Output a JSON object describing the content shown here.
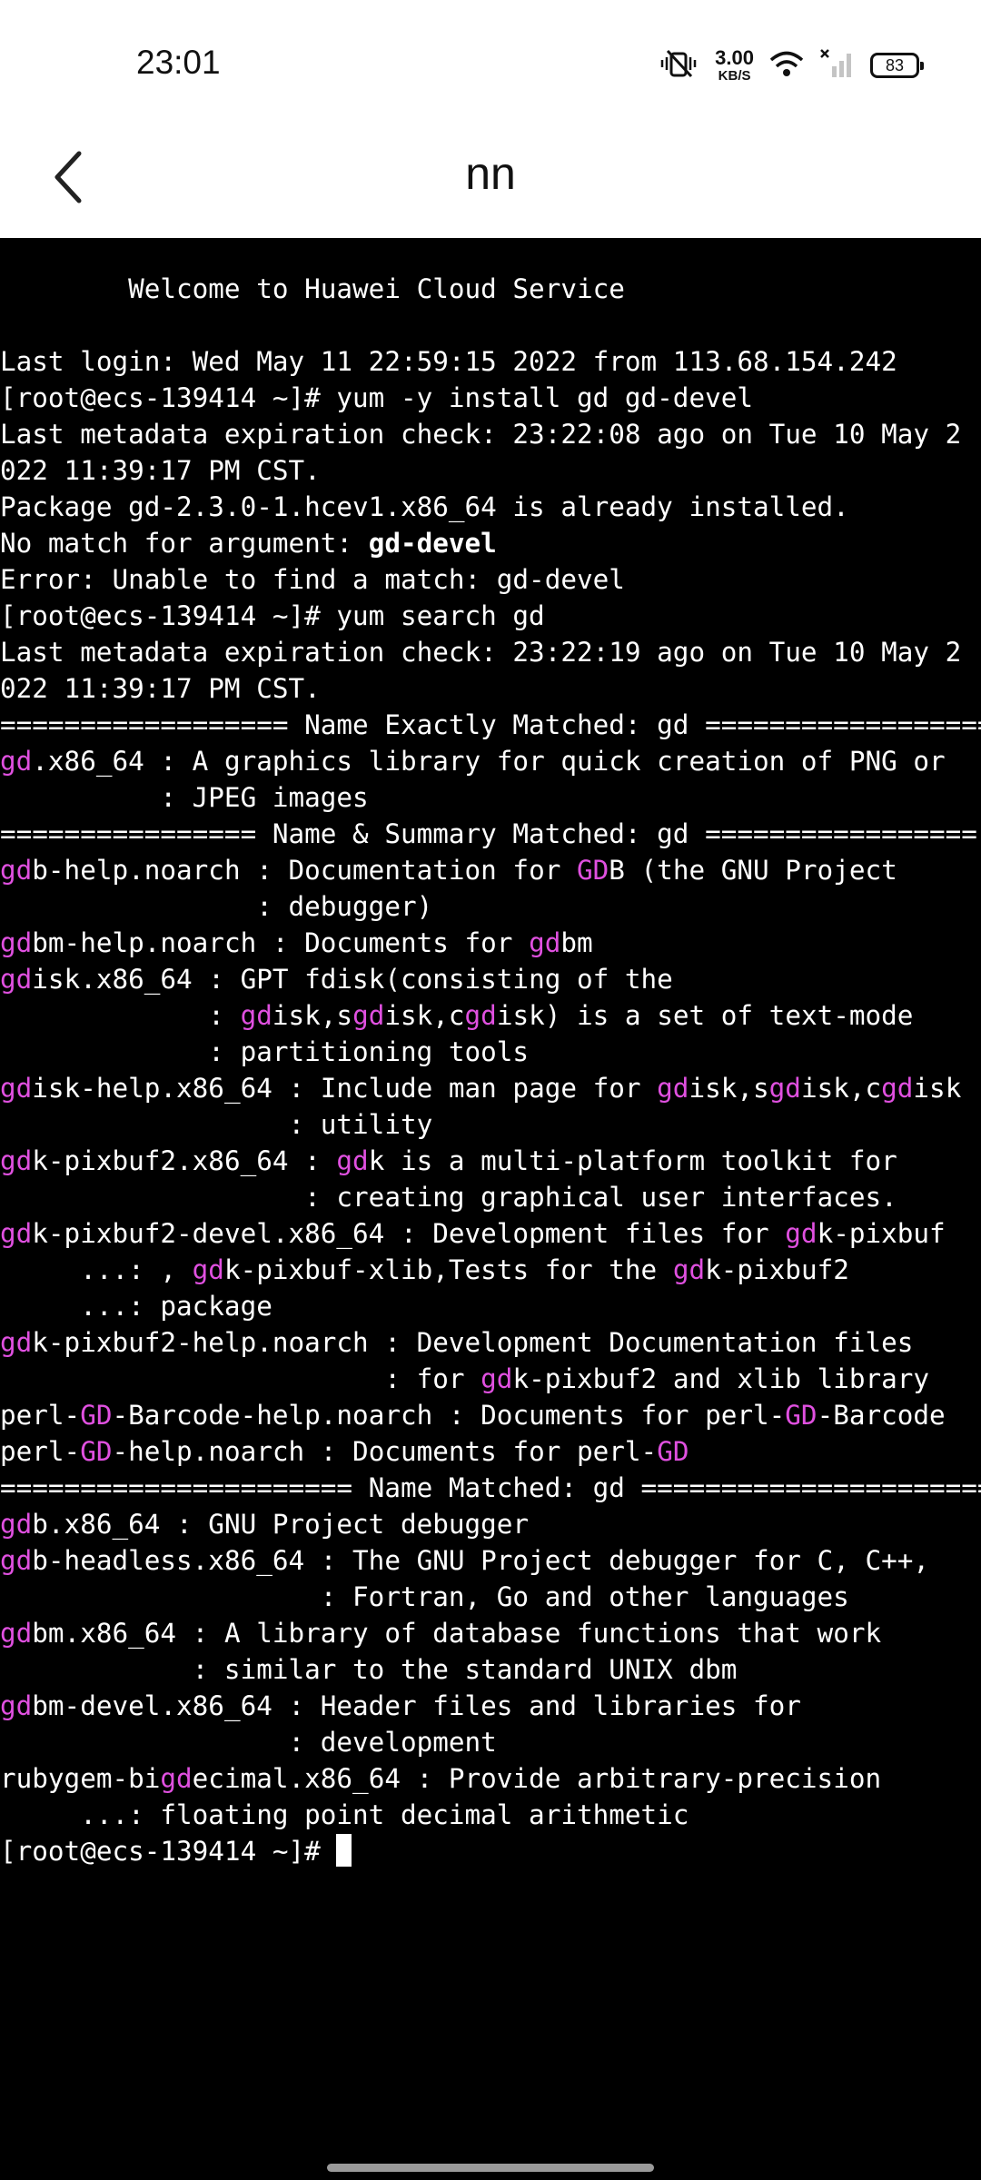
{
  "status_bar": {
    "time": "23:01",
    "net_speed_value": "3.00",
    "net_speed_unit": "KB/S",
    "battery": "83",
    "icons": [
      "vibrate-mute-icon",
      "wifi-icon",
      "cellular-no-signal-icon",
      "battery-icon"
    ]
  },
  "header": {
    "title": "nn",
    "back_icon": "chevron-left-icon"
  },
  "terminal": {
    "highlight_color": "#e050e0",
    "background": "#000000",
    "foreground": "#ffffff",
    "lines": [
      [
        {
          "t": "        Welcome to Huawei Cloud Service"
        }
      ],
      [
        {
          "t": ""
        }
      ],
      [
        {
          "t": "Last login: Wed May 11 22:59:15 2022 from 113.68.154.242"
        }
      ],
      [
        {
          "t": "[root@ecs-139414 ~]# yum -y install gd gd-devel"
        }
      ],
      [
        {
          "t": "Last metadata expiration check: 23:22:08 ago on Tue 10 May 2"
        }
      ],
      [
        {
          "t": "022 11:39:17 PM CST."
        }
      ],
      [
        {
          "t": "Package gd-2.3.0-1.hcev1.x86_64 is already installed."
        }
      ],
      [
        {
          "t": "No match for argument: "
        },
        {
          "t": "gd-devel",
          "s": "bold"
        }
      ],
      [
        {
          "t": "Error: Unable to find a match: gd-devel"
        }
      ],
      [
        {
          "t": "[root@ecs-139414 ~]# yum search gd"
        }
      ],
      [
        {
          "t": "Last metadata expiration check: 23:22:19 ago on Tue 10 May 2"
        }
      ],
      [
        {
          "t": "022 11:39:17 PM CST."
        }
      ],
      [
        {
          "t": "================== Name Exactly Matched: gd =================="
        }
      ],
      [
        {
          "t": "gd",
          "s": "hl"
        },
        {
          "t": ".x86_64 : A graphics library for quick creation of PNG or"
        }
      ],
      [
        {
          "t": "          : JPEG images"
        }
      ],
      [
        {
          "t": "================ Name & Summary Matched: gd ================="
        }
      ],
      [
        {
          "t": "gd",
          "s": "hl"
        },
        {
          "t": "b-help.noarch : Documentation for "
        },
        {
          "t": "GD",
          "s": "hl"
        },
        {
          "t": "B (the GNU Project"
        }
      ],
      [
        {
          "t": "                : debugger)"
        }
      ],
      [
        {
          "t": "gd",
          "s": "hl"
        },
        {
          "t": "bm-help.noarch : Documents for "
        },
        {
          "t": "gd",
          "s": "hl"
        },
        {
          "t": "bm"
        }
      ],
      [
        {
          "t": "gd",
          "s": "hl"
        },
        {
          "t": "isk.x86_64 : GPT fdisk(consisting of the"
        }
      ],
      [
        {
          "t": "             : "
        },
        {
          "t": "gd",
          "s": "hl"
        },
        {
          "t": "isk,s"
        },
        {
          "t": "gd",
          "s": "hl"
        },
        {
          "t": "isk,c"
        },
        {
          "t": "gd",
          "s": "hl"
        },
        {
          "t": "isk) is a set of text-mode"
        }
      ],
      [
        {
          "t": "             : partitioning tools"
        }
      ],
      [
        {
          "t": "gd",
          "s": "hl"
        },
        {
          "t": "isk-help.x86_64 : Include man page for "
        },
        {
          "t": "gd",
          "s": "hl"
        },
        {
          "t": "isk,s"
        },
        {
          "t": "gd",
          "s": "hl"
        },
        {
          "t": "isk,c"
        },
        {
          "t": "gd",
          "s": "hl"
        },
        {
          "t": "isk"
        }
      ],
      [
        {
          "t": "                  : utility"
        }
      ],
      [
        {
          "t": "gd",
          "s": "hl"
        },
        {
          "t": "k-pixbuf2.x86_64 : "
        },
        {
          "t": "gd",
          "s": "hl"
        },
        {
          "t": "k is a multi-platform toolkit for"
        }
      ],
      [
        {
          "t": "                   : creating graphical user interfaces."
        }
      ],
      [
        {
          "t": "gd",
          "s": "hl"
        },
        {
          "t": "k-pixbuf2-devel.x86_64 : Development files for "
        },
        {
          "t": "gd",
          "s": "hl"
        },
        {
          "t": "k-pixbuf"
        }
      ],
      [
        {
          "t": "     ...: , "
        },
        {
          "t": "gd",
          "s": "hl"
        },
        {
          "t": "k-pixbuf-xlib,Tests for the "
        },
        {
          "t": "gd",
          "s": "hl"
        },
        {
          "t": "k-pixbuf2"
        }
      ],
      [
        {
          "t": "     ...: package"
        }
      ],
      [
        {
          "t": "gd",
          "s": "hl"
        },
        {
          "t": "k-pixbuf2-help.noarch : Development Documentation files"
        }
      ],
      [
        {
          "t": "                        : for "
        },
        {
          "t": "gd",
          "s": "hl"
        },
        {
          "t": "k-pixbuf2 and xlib library"
        }
      ],
      [
        {
          "t": "perl-"
        },
        {
          "t": "GD",
          "s": "hl"
        },
        {
          "t": "-Barcode-help.noarch : Documents for perl-"
        },
        {
          "t": "GD",
          "s": "hl"
        },
        {
          "t": "-Barcode"
        }
      ],
      [
        {
          "t": "perl-"
        },
        {
          "t": "GD",
          "s": "hl"
        },
        {
          "t": "-help.noarch : Documents for perl-"
        },
        {
          "t": "GD",
          "s": "hl"
        }
      ],
      [
        {
          "t": "====================== Name Matched: gd ======================"
        }
      ],
      [
        {
          "t": "gd",
          "s": "hl"
        },
        {
          "t": "b.x86_64 : GNU Project debugger"
        }
      ],
      [
        {
          "t": "gd",
          "s": "hl"
        },
        {
          "t": "b-headless.x86_64 : The GNU Project debugger for C, C++,"
        }
      ],
      [
        {
          "t": "                    : Fortran, Go and other languages"
        }
      ],
      [
        {
          "t": "gd",
          "s": "hl"
        },
        {
          "t": "bm.x86_64 : A library of database functions that work"
        }
      ],
      [
        {
          "t": "            : similar to the standard UNIX dbm"
        }
      ],
      [
        {
          "t": "gd",
          "s": "hl"
        },
        {
          "t": "bm-devel.x86_64 : Header files and libraries for"
        }
      ],
      [
        {
          "t": "                  : development"
        }
      ],
      [
        {
          "t": "rubygem-bi"
        },
        {
          "t": "gd",
          "s": "hl"
        },
        {
          "t": "ecimal.x86_64 : Provide arbitrary-precision"
        }
      ],
      [
        {
          "t": "     ...: floating point decimal arithmetic"
        }
      ],
      [
        {
          "t": "[root@ecs-139414 ~]# "
        }
      ]
    ]
  }
}
